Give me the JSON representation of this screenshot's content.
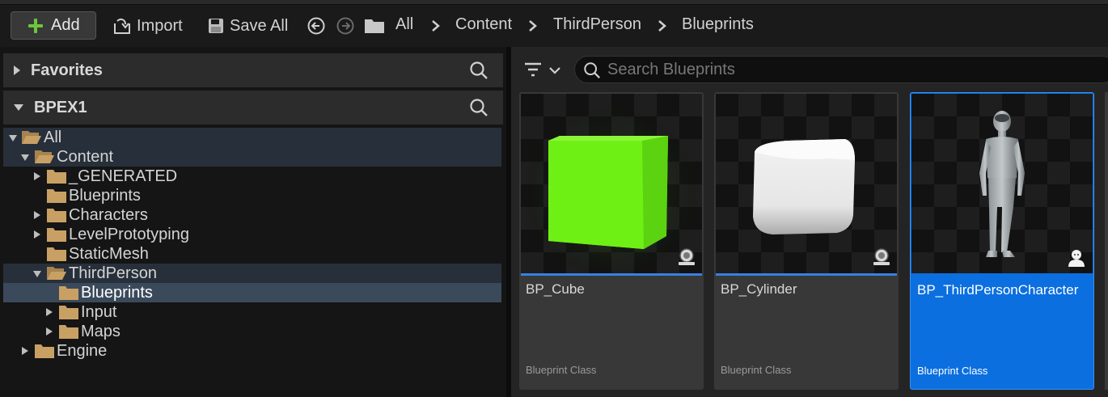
{
  "toolbar": {
    "add_label": "Add",
    "import_label": "Import",
    "save_all_label": "Save All",
    "breadcrumbs": [
      "All",
      "Content",
      "ThirdPerson",
      "Blueprints"
    ]
  },
  "favorites": {
    "title": "Favorites"
  },
  "project": {
    "title": "BPEX1"
  },
  "tree": [
    {
      "label": "All"
    },
    {
      "label": "Content"
    },
    {
      "label": "_GENERATED"
    },
    {
      "label": "Blueprints"
    },
    {
      "label": "Characters"
    },
    {
      "label": "LevelPrototyping"
    },
    {
      "label": "StaticMesh"
    },
    {
      "label": "ThirdPerson"
    },
    {
      "label": "Blueprints"
    },
    {
      "label": "Input"
    },
    {
      "label": "Maps"
    },
    {
      "label": "Engine"
    }
  ],
  "search": {
    "placeholder": "Search Blueprints"
  },
  "assets": [
    {
      "name": "BP_Cube",
      "type": "Blueprint Class",
      "icon": "pawn-icon"
    },
    {
      "name": "BP_Cylinder",
      "type": "Blueprint Class",
      "icon": "pawn-icon"
    },
    {
      "name": "BP_ThirdPersonCharacter",
      "type": "Blueprint Class",
      "icon": "character-icon"
    }
  ],
  "colors": {
    "accent": "#0b6fe0",
    "folder": "#c9a064",
    "add_green": "#6dc53b",
    "asset_bar": "#3b7fe0"
  }
}
